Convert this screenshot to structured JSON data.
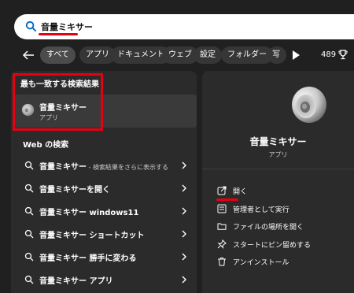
{
  "search": {
    "query": "音量ミキサー"
  },
  "filters": {
    "chips": [
      "すべて",
      "アプリ",
      "ドキュメント",
      "ウェブ",
      "設定",
      "フォルダー",
      "写"
    ],
    "points": "489"
  },
  "best_match": {
    "heading": "最も一致する検索結果",
    "title": "音量ミキサー",
    "subtitle": "アプリ"
  },
  "web": {
    "heading": "Web の検索",
    "items": [
      {
        "label": "音量ミキサー",
        "suffix": " - 検索結果をさらに表示する"
      },
      {
        "label": "音量ミキサーを開く",
        "suffix": ""
      },
      {
        "label": "音量ミキサー windows11",
        "suffix": ""
      },
      {
        "label": "音量ミキサー ショートカット",
        "suffix": ""
      },
      {
        "label": "音量ミキサー 勝手に変わる",
        "suffix": ""
      },
      {
        "label": "音量ミキサー アプリ",
        "suffix": ""
      }
    ]
  },
  "details": {
    "title": "音量ミキサー",
    "type": "アプリ",
    "actions": [
      {
        "label": "開く",
        "icon": "open-external-icon"
      },
      {
        "label": "管理者として実行",
        "icon": "shield-admin-icon"
      },
      {
        "label": "ファイルの場所を開く",
        "icon": "folder-icon"
      },
      {
        "label": "スタートにピン留めする",
        "icon": "pin-icon"
      },
      {
        "label": "アンインストール",
        "icon": "trash-icon"
      }
    ]
  },
  "colors": {
    "accent_red": "#e60012",
    "background": "#202020",
    "panel": "#2b2b2b"
  }
}
